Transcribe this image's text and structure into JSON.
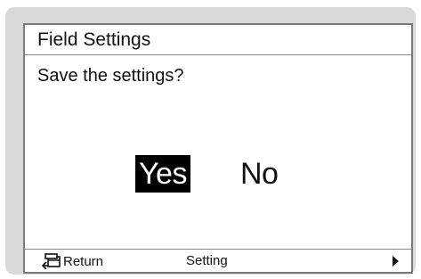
{
  "screen": {
    "title": "Field Settings",
    "prompt": "Save the settings?"
  },
  "choices": {
    "yes": "Yes",
    "no": "No",
    "selected": "Yes"
  },
  "footer": {
    "return_label": "Return",
    "return_icon": "return-icon",
    "center_label": "Setting",
    "next_icon": "right-arrow-icon"
  },
  "colors": {
    "frame": "#d9d9d9",
    "screen_bg": "#ffffff",
    "highlight_bg": "#000000",
    "highlight_text": "#ffffff",
    "text": "#111111"
  }
}
